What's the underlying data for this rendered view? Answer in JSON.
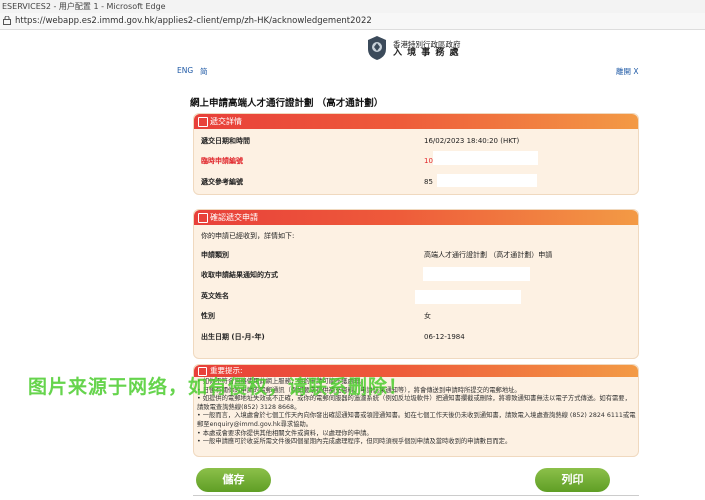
{
  "window": {
    "title": "ESERVICES2 - 用户配置 1 - Microsoft Edge",
    "url": "https://webapp.es2.immd.gov.hk/applies2-client/emp/zh-HK/acknowledgement2022"
  },
  "header": {
    "agency_line1": "香港特別行政區政府",
    "agency_line2": "入 境 事 務 處",
    "lang_eng": "ENG",
    "lang_sc": "简",
    "close": "離開 X"
  },
  "page_title": "網上申請高端人才通行證計劃 （高才通計劃）",
  "submission": {
    "section_title": "遞交詳情",
    "rows": [
      {
        "label": "遞交日期和時間",
        "value": "16/02/2023 18:40:20 (HKT)"
      },
      {
        "label": "臨時申請編號",
        "value": "10"
      },
      {
        "label": "遞交參考編號",
        "value": "85"
      }
    ]
  },
  "confirmation": {
    "section_title": "確認遞交申請",
    "intro": "你的申請已經收到，詳情如下:",
    "rows": [
      {
        "label": "申請類別",
        "value": "高端人才通行證計劃 （高才通計劃）申請"
      },
      {
        "label": "收取申請結果通知的方式",
        "value": ""
      },
      {
        "label": "英文姓名",
        "value": ""
      },
      {
        "label": "性別",
        "value": "女"
      },
      {
        "label": "出生日期 (日-月-年)",
        "value": "06-12-1984"
      }
    ]
  },
  "important": {
    "section_title": "重要提示:",
    "notes": [
      "• 如你不符合資格使用此網上服務，你的申請可能不獲處理。",
      "• 日後有關你的申請的電郵通訊（例如要求提供補充資料、申請結果通知等），將會傳送到申請時所提交的電郵地址。",
      "• 如提供的電郵地址失效或不正確，或你的電郵伺服器的過濾系統（例如反垃圾軟件）把通知書攔截或刪除，將導致通知書無法以電子方式傳送。如有需要，",
      "  請致電查詢熱線(852) 3128 8668。",
      "• 一般而言，入境處會於七個工作天內向你發出確認通知書或領證通知書。如在七個工作天後仍未收到通知書，請致電入境處查詢熱線 (852) 2824 6111或電",
      "  郵至enquiry@immd.gov.hk尋求協助。",
      "• 本處或會要求你提供其他相關文件或資料，以處理你的申請。",
      "• 一般申請應可於收妥所需文件後四個星期內完成處理程序，但同時須視乎個別申請及當時收到的申請數目而定。"
    ]
  },
  "watermark": "图片来源于网络，如有侵权，请联系删除！",
  "buttons": {
    "save": "儲存",
    "print": "列印"
  }
}
